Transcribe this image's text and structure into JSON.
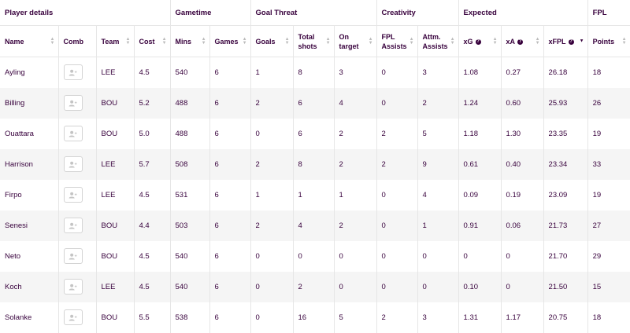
{
  "groups": [
    {
      "label": "Player details",
      "span": 4
    },
    {
      "label": "Gametime",
      "span": 2
    },
    {
      "label": "Goal Threat",
      "span": 3
    },
    {
      "label": "Creativity",
      "span": 2
    },
    {
      "label": "Expected",
      "span": 3
    },
    {
      "label": "FPL",
      "span": 1
    }
  ],
  "columns": [
    {
      "label": "Name",
      "sortable": true
    },
    {
      "label": "Comb",
      "sortable": false
    },
    {
      "label": "Team",
      "sortable": true
    },
    {
      "label": "Cost",
      "sortable": true
    },
    {
      "label": "Mins",
      "sortable": true
    },
    {
      "label": "Games",
      "sortable": true
    },
    {
      "label": "Goals",
      "sortable": true
    },
    {
      "label": "Total shots",
      "sortable": true
    },
    {
      "label": "On target",
      "sortable": true
    },
    {
      "label": "FPL Assists",
      "sortable": true
    },
    {
      "label": "Attm. Assists",
      "sortable": true
    },
    {
      "label": "xG",
      "sortable": true,
      "info": true
    },
    {
      "label": "xA",
      "sortable": true,
      "info": true
    },
    {
      "label": "xFPL",
      "sortable": true,
      "info": true,
      "active_sort": "desc"
    },
    {
      "label": "Points",
      "sortable": true
    }
  ],
  "rows": [
    {
      "name": "Ayling",
      "team": "LEE",
      "cost": "4.5",
      "mins": "540",
      "games": "6",
      "goals": "1",
      "shots": "8",
      "on_target": "3",
      "fpl_assists": "0",
      "attm_assists": "3",
      "xg": "1.08",
      "xa": "0.27",
      "xfpl": "26.18",
      "points": "18"
    },
    {
      "name": "Billing",
      "team": "BOU",
      "cost": "5.2",
      "mins": "488",
      "games": "6",
      "goals": "2",
      "shots": "6",
      "on_target": "4",
      "fpl_assists": "0",
      "attm_assists": "2",
      "xg": "1.24",
      "xa": "0.60",
      "xfpl": "25.93",
      "points": "26"
    },
    {
      "name": "Ouattara",
      "team": "BOU",
      "cost": "5.0",
      "mins": "488",
      "games": "6",
      "goals": "0",
      "shots": "6",
      "on_target": "2",
      "fpl_assists": "2",
      "attm_assists": "5",
      "xg": "1.18",
      "xa": "1.30",
      "xfpl": "23.35",
      "points": "19"
    },
    {
      "name": "Harrison",
      "team": "LEE",
      "cost": "5.7",
      "mins": "508",
      "games": "6",
      "goals": "2",
      "shots": "8",
      "on_target": "2",
      "fpl_assists": "2",
      "attm_assists": "9",
      "xg": "0.61",
      "xa": "0.40",
      "xfpl": "23.34",
      "points": "33"
    },
    {
      "name": "Firpo",
      "team": "LEE",
      "cost": "4.5",
      "mins": "531",
      "games": "6",
      "goals": "1",
      "shots": "1",
      "on_target": "1",
      "fpl_assists": "0",
      "attm_assists": "4",
      "xg": "0.09",
      "xa": "0.19",
      "xfpl": "23.09",
      "points": "19"
    },
    {
      "name": "Senesi",
      "team": "BOU",
      "cost": "4.4",
      "mins": "503",
      "games": "6",
      "goals": "2",
      "shots": "4",
      "on_target": "2",
      "fpl_assists": "0",
      "attm_assists": "1",
      "xg": "0.91",
      "xa": "0.06",
      "xfpl": "21.73",
      "points": "27"
    },
    {
      "name": "Neto",
      "team": "BOU",
      "cost": "4.5",
      "mins": "540",
      "games": "6",
      "goals": "0",
      "shots": "0",
      "on_target": "0",
      "fpl_assists": "0",
      "attm_assists": "0",
      "xg": "0",
      "xa": "0",
      "xfpl": "21.70",
      "points": "29"
    },
    {
      "name": "Koch",
      "team": "LEE",
      "cost": "4.5",
      "mins": "540",
      "games": "6",
      "goals": "0",
      "shots": "2",
      "on_target": "0",
      "fpl_assists": "0",
      "attm_assists": "0",
      "xg": "0.10",
      "xa": "0",
      "xfpl": "21.50",
      "points": "15"
    },
    {
      "name": "Solanke",
      "team": "BOU",
      "cost": "5.5",
      "mins": "538",
      "games": "6",
      "goals": "0",
      "shots": "16",
      "on_target": "5",
      "fpl_assists": "2",
      "attm_assists": "3",
      "xg": "1.31",
      "xa": "1.17",
      "xfpl": "20.75",
      "points": "18"
    }
  ],
  "icons": {
    "comb": "add-user-icon",
    "sort": "sort-arrows-icon",
    "info": "info-icon"
  },
  "colors": {
    "text": "#37003c",
    "stripe": "#f5f5f5",
    "border": "#e6e6e6"
  }
}
